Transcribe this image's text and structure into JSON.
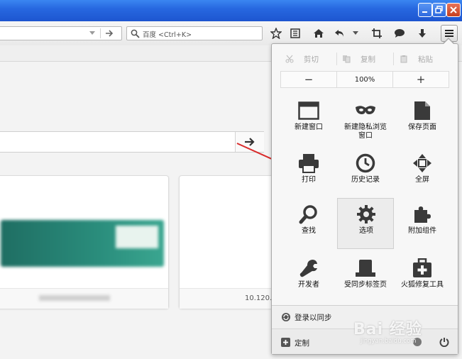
{
  "colors": {
    "titlebar": "#2768e0",
    "close": "#c5401f",
    "arrow": "#d92b2b",
    "icon": "#3a3a3a"
  },
  "search": {
    "placeholder": "百度 <Ctrl+K>"
  },
  "edit": {
    "cut": "剪切",
    "copy": "复制",
    "paste": "粘贴"
  },
  "zoom": {
    "out": "−",
    "level": "100%",
    "in": "+"
  },
  "panel_items": [
    {
      "label": "新建窗口",
      "icon": "new-window-icon"
    },
    {
      "label": "新建隐私浏览窗口",
      "icon": "private-mask-icon"
    },
    {
      "label": "保存页面",
      "icon": "save-page-icon"
    },
    {
      "label": "打印",
      "icon": "print-icon"
    },
    {
      "label": "历史记录",
      "icon": "history-clock-icon"
    },
    {
      "label": "全屏",
      "icon": "fullscreen-icon"
    },
    {
      "label": "查找",
      "icon": "find-magnifier-icon"
    },
    {
      "label": "选项",
      "icon": "options-gear-icon"
    },
    {
      "label": "附加组件",
      "icon": "addons-puzzle-icon"
    },
    {
      "label": "开发者",
      "icon": "developer-wrench-icon"
    },
    {
      "label": "受同步标签页",
      "icon": "synced-tabs-icon"
    },
    {
      "label": "火狐修复工具",
      "icon": "repair-kit-icon"
    }
  ],
  "panel_item_label_lines": {
    "private_1": "新建隐私浏览",
    "private_2": "窗口"
  },
  "footer": {
    "sync": "登录以同步",
    "customize": "定制"
  },
  "tiles": {
    "tile2_caption": "10.120."
  },
  "watermark": {
    "brand": "Bai 经验",
    "sub": "jingyan.baidu.com"
  }
}
